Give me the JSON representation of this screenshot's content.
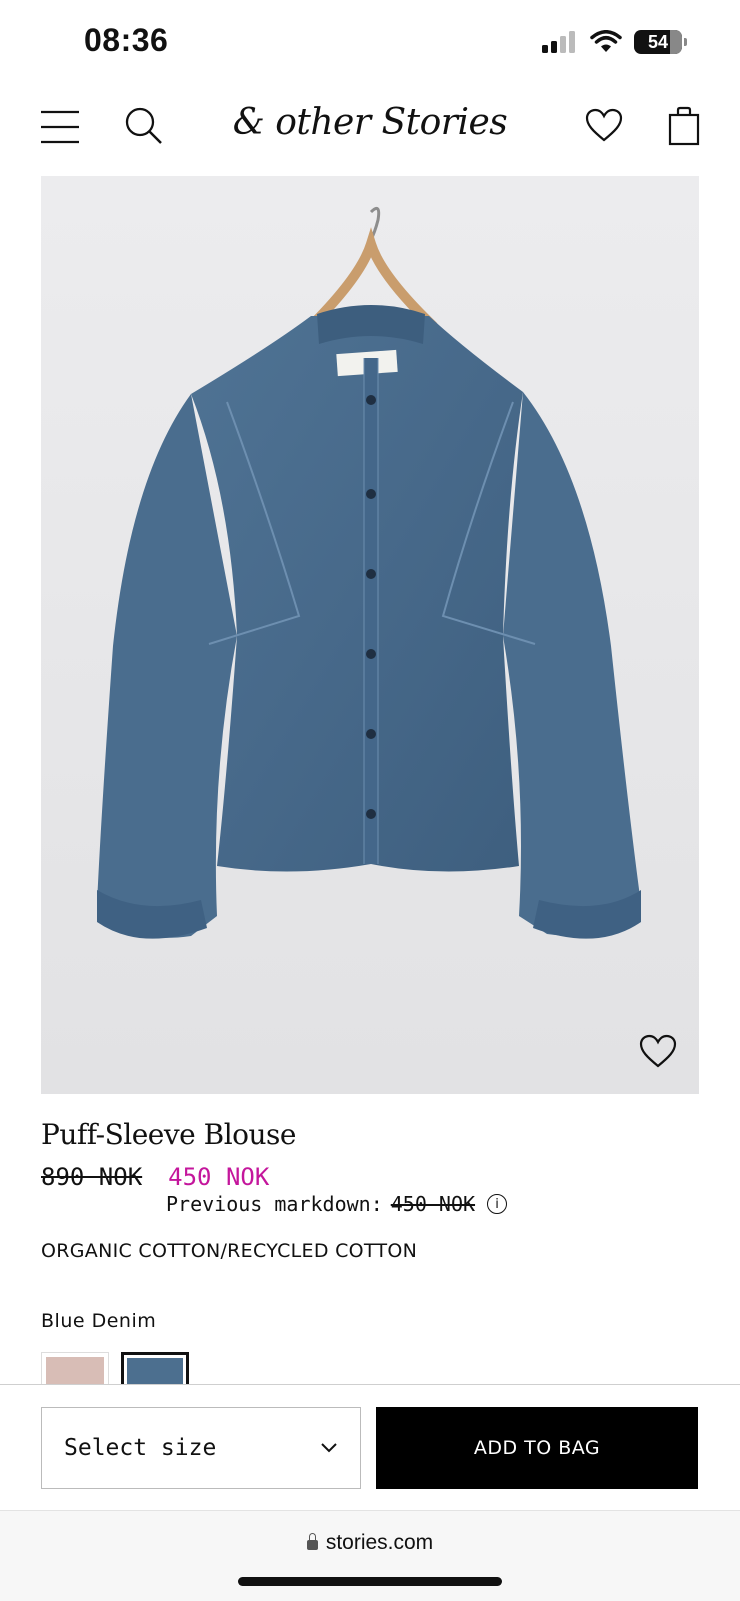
{
  "status_bar": {
    "time": "08:36",
    "battery": "54"
  },
  "header": {
    "brand": "& other Stories"
  },
  "product": {
    "title": "Puff-Sleeve Blouse",
    "original_price": "890 NOK",
    "sale_price": "450 NOK",
    "markdown_label": "Previous markdown:",
    "markdown_price": "450 NOK",
    "material": "ORGANIC COTTON/RECYCLED COTTON",
    "color_name": "Blue Denim",
    "swatch_colors": [
      "#d8bdb6",
      "#4c6f8f"
    ]
  },
  "actions": {
    "size_select": "Select size",
    "add_to_bag": "ADD TO BAG"
  },
  "browser": {
    "url": "stories.com"
  },
  "colors": {
    "sale": "#c4169c",
    "button": "#000000"
  }
}
